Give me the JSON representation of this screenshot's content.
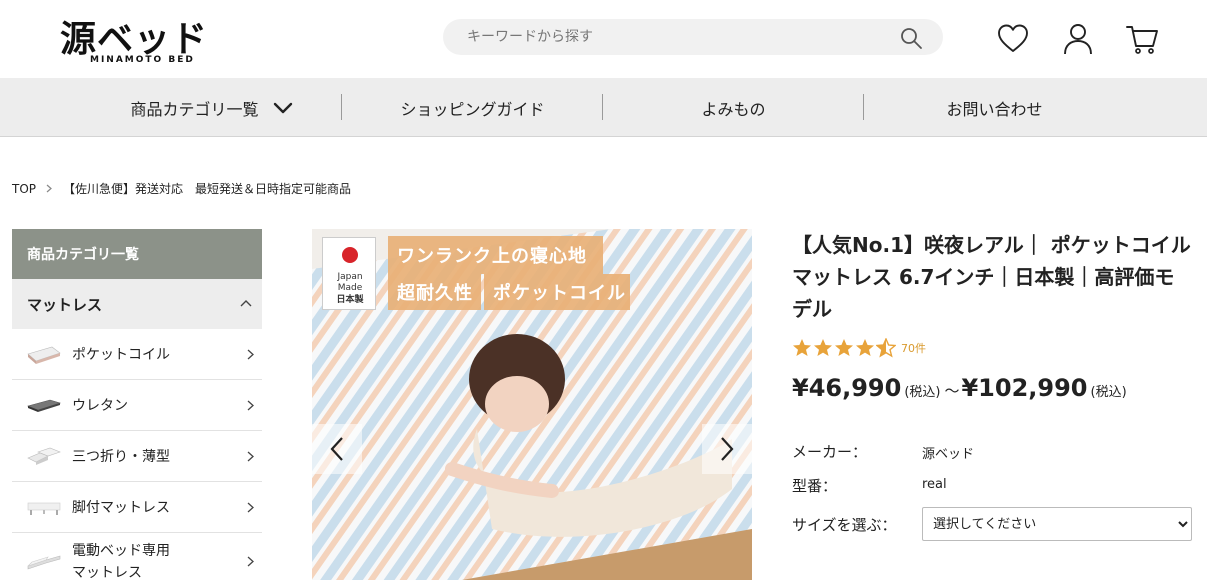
{
  "header": {
    "logo_main": "源ベッド",
    "logo_sub": "MINAMOTO BED",
    "search_placeholder": "キーワードから探す",
    "icons": [
      "search-icon",
      "heart-icon",
      "user-icon",
      "cart-icon"
    ]
  },
  "nav": {
    "items": [
      "商品カテゴリ一覧",
      "ショッピングガイド",
      "よみもの",
      "お問い合わせ"
    ]
  },
  "breadcrumb": {
    "items": [
      "TOP",
      "【佐川急便】発送対応　最短発送＆日時指定可能商品"
    ]
  },
  "sidebar": {
    "heading": "商品カテゴリ一覧",
    "section": "マットレス",
    "items": [
      {
        "label": "ポケットコイル"
      },
      {
        "label": "ウレタン"
      },
      {
        "label": "三つ折り・薄型"
      },
      {
        "label": "脚付マットレス"
      },
      {
        "label_line1": "電動ベッド専用",
        "label_line2": "マットレス"
      }
    ]
  },
  "gallery": {
    "badge_line1": "Japan",
    "badge_line2": "Made",
    "badge_line3": "日本製",
    "tag1": "ワンランク上の寝心地",
    "tag2": "超耐久性",
    "tag3": "ポケットコイル"
  },
  "product": {
    "title": "【人気No.1】咲夜レアル｜ ポケットコイルマットレス 6.7インチ｜日本製｜高評価モデル",
    "rating": 4.5,
    "rating_count": "70件",
    "price_min": "¥46,990",
    "price_max": "¥102,990",
    "tax_label": "(税込)",
    "price_sep": "～",
    "maker_label": "メーカー：",
    "maker_value": "源ベッド",
    "model_label": "型番：",
    "model_value": "real",
    "size_label": "サイズを選ぶ：",
    "size_selected": "選択してください"
  },
  "colors": {
    "sidebar_header": "#8c9289",
    "nav_bg": "#ededed",
    "star": "#e8a33a"
  }
}
